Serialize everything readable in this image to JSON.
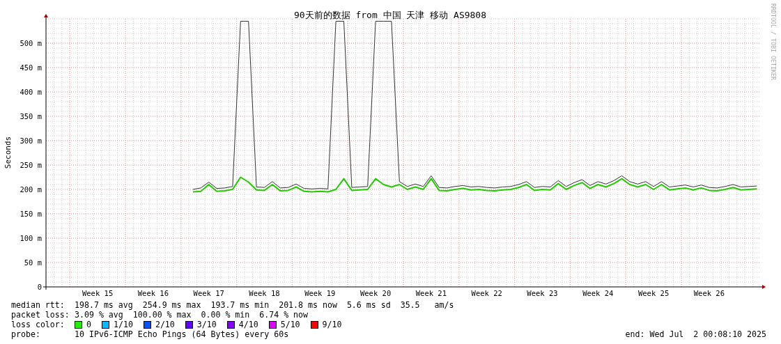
{
  "chart": {
    "credit": "RRDTOOL / TOBI OETIKER",
    "chart_data": {
      "type": "line",
      "title": "90天前的数据 from 中国 天津 移动 AS9808",
      "ylabel": "Seconds",
      "ylim": [
        0,
        550
      ],
      "grid": true,
      "categories": [
        null,
        null,
        null,
        null,
        null,
        null,
        "Week 15",
        null,
        null,
        null,
        null,
        null,
        null,
        "Week 16",
        null,
        null,
        null,
        null,
        null,
        null,
        "Week 17",
        null,
        null,
        null,
        null,
        null,
        null,
        "Week 18",
        null,
        null,
        null,
        null,
        null,
        null,
        "Week 19",
        null,
        null,
        null,
        null,
        null,
        null,
        "Week 20",
        null,
        null,
        null,
        null,
        null,
        null,
        "Week 21",
        null,
        null,
        null,
        null,
        null,
        null,
        "Week 22",
        null,
        null,
        null,
        null,
        null,
        null,
        "Week 23",
        null,
        null,
        null,
        null,
        null,
        null,
        "Week 24",
        null,
        null,
        null,
        null,
        null,
        null,
        "Week 25",
        null,
        null,
        null,
        null,
        null,
        null,
        "Week 26",
        null,
        null,
        null,
        null,
        null,
        null
      ],
      "yticks": [
        {
          "value": 0,
          "label": "0"
        },
        {
          "value": 50,
          "label": "50 m"
        },
        {
          "value": 100,
          "label": "100 m"
        },
        {
          "value": 150,
          "label": "150 m"
        },
        {
          "value": 200,
          "label": "200 m"
        },
        {
          "value": 250,
          "label": "250 m"
        },
        {
          "value": 300,
          "label": "300 m"
        },
        {
          "value": 350,
          "label": "350 m"
        },
        {
          "value": 400,
          "label": "400 m"
        },
        {
          "value": 450,
          "label": "450 m"
        },
        {
          "value": 500,
          "label": "500 m"
        }
      ],
      "series": [
        {
          "color": "#333333",
          "values": [
            null,
            null,
            null,
            null,
            null,
            null,
            null,
            null,
            null,
            null,
            null,
            null,
            null,
            null,
            null,
            null,
            null,
            null,
            200,
            203,
            215,
            202,
            203,
            206,
            545,
            545,
            205,
            204,
            216,
            203,
            204,
            211,
            202,
            201,
            202,
            201,
            545,
            545,
            204,
            205,
            206,
            545,
            545,
            545,
            216,
            206,
            211,
            206,
            228,
            204,
            203,
            206,
            208,
            205,
            206,
            204,
            203,
            205,
            206,
            210,
            216,
            204,
            206,
            205,
            218,
            206,
            214,
            220,
            208,
            216,
            211,
            218,
            228,
            216,
            211,
            216,
            206,
            216,
            205,
            207,
            209,
            205,
            209,
            204,
            203,
            206,
            210,
            205,
            206,
            207
          ]
        },
        {
          "color": "#22cc00",
          "values": [
            null,
            null,
            null,
            null,
            null,
            null,
            null,
            null,
            null,
            null,
            null,
            null,
            null,
            null,
            null,
            null,
            null,
            null,
            195,
            196,
            210,
            196,
            197,
            200,
            225,
            215,
            199,
            198,
            210,
            197,
            198,
            205,
            196,
            195,
            196,
            195,
            200,
            222,
            198,
            199,
            200,
            222,
            210,
            205,
            210,
            200,
            205,
            200,
            222,
            198,
            197,
            200,
            202,
            199,
            200,
            198,
            197,
            199,
            200,
            204,
            210,
            198,
            200,
            199,
            212,
            200,
            208,
            214,
            202,
            210,
            205,
            212,
            222,
            210,
            205,
            210,
            200,
            210,
            199,
            201,
            203,
            199,
            203,
            198,
            197,
            200,
            204,
            199,
            200,
            201
          ]
        }
      ]
    }
  },
  "legend": {
    "rtt": {
      "label": "median rtt:",
      "values": "198.7 ms avg  254.9 ms max  193.7 ms min  201.8 ms now  5.6 ms sd  35.5   am/s"
    },
    "loss": {
      "label": "packet loss:",
      "values": "3.09 % avg  100.00 % max  0.00 % min  6.74 % now"
    },
    "loss_color": {
      "label": "loss color:",
      "items": [
        {
          "label": "0",
          "color": "#22ee00"
        },
        {
          "label": "1/10",
          "color": "#00bbff"
        },
        {
          "label": "2/10",
          "color": "#0055ff"
        },
        {
          "label": "3/10",
          "color": "#6600ff"
        },
        {
          "label": "4/10",
          "color": "#8800ff"
        },
        {
          "label": "5/10",
          "color": "#dd00ff"
        },
        {
          "label": "9/10",
          "color": "#ff0000"
        }
      ]
    },
    "probe": {
      "label": "probe:",
      "values": "10 IPv6-ICMP Echo Pings (64 Bytes) every 60s"
    },
    "end": "end: Wed Jul  2 00:08:10 2025"
  }
}
